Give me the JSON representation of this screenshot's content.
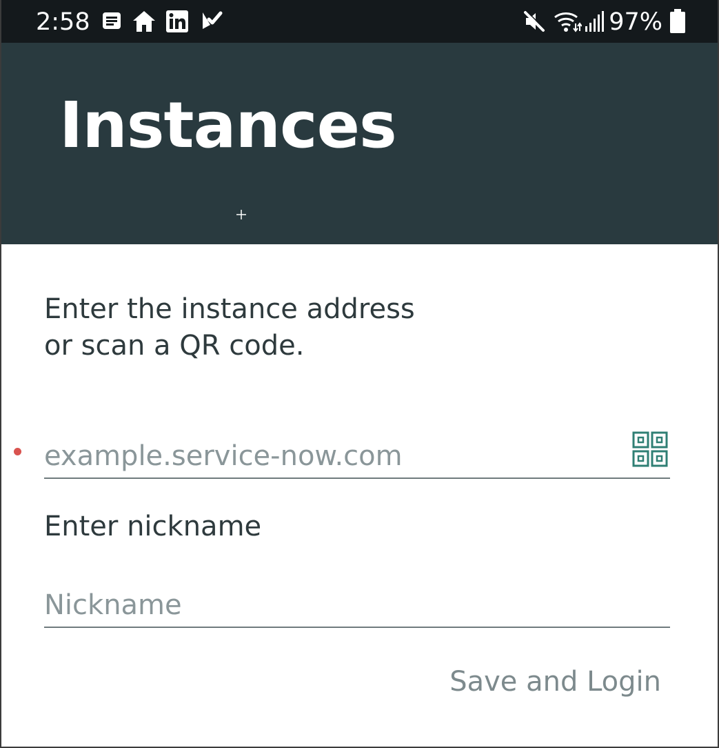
{
  "status_bar": {
    "time": "2:58",
    "notification_icons": [
      "news-icon",
      "home-icon",
      "linkedin-icon",
      "tasks-icon"
    ],
    "system_icons": [
      "mute-icon",
      "wifi-icon",
      "signal-icon",
      "battery-icon"
    ],
    "battery_percent": "97%"
  },
  "header": {
    "title": "Instances",
    "background_color": "#293a3f"
  },
  "form": {
    "instructions_line1": "Enter the instance address",
    "instructions_line2": "or scan a QR code.",
    "instance_placeholder": "example.service-now.com",
    "instance_value": "",
    "required_indicator_color": "#d9534f",
    "qr_icon": "qr-code-icon",
    "nickname_label": "Enter nickname",
    "nickname_placeholder": "Nickname",
    "nickname_value": "",
    "save_button_label": "Save and Login",
    "accent_color": "#2f7f74"
  }
}
